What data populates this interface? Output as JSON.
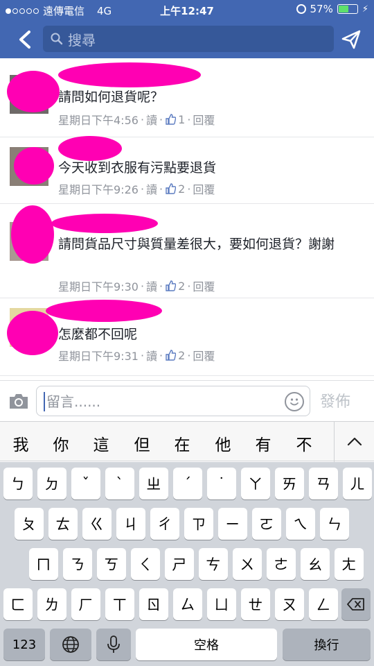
{
  "status_bar": {
    "carrier": "遠傳電信",
    "network": "4G",
    "time": "上午12:47",
    "battery_percent": "57%",
    "battery_level": 0.57
  },
  "nav": {
    "search_placeholder": "搜尋"
  },
  "comments": [
    {
      "text": "請問如何退貨呢？",
      "time": "星期日下午4:56",
      "read": "讀",
      "likes": "1",
      "reply": "回覆"
    },
    {
      "text": "今天收到衣服有污點要退貨",
      "time": "星期日下午9:26",
      "read": "讀",
      "likes": "2",
      "reply": "回覆"
    },
    {
      "text": "請問貨品尺寸與質量差很大，要如何退貨？謝謝",
      "time": "星期日下午9:30",
      "read": "讀",
      "likes": "2",
      "reply": "回覆"
    },
    {
      "text": "怎麼都不回呢",
      "time": "星期日下午9:31",
      "read": "讀",
      "likes": "2",
      "reply": "回覆"
    }
  ],
  "comment_input": {
    "placeholder": "留言......",
    "post_label": "發佈"
  },
  "candidates": [
    "我",
    "你",
    "這",
    "但",
    "在",
    "他",
    "有",
    "不"
  ],
  "keyboard": {
    "row1": [
      "ㄅ",
      "ㄉ",
      "ˇ",
      "ˋ",
      "ㄓ",
      "ˊ",
      "˙",
      "ㄚ",
      "ㄞ",
      "ㄢ",
      "ㄦ"
    ],
    "row2": [
      "ㄆ",
      "ㄊ",
      "ㄍ",
      "ㄐ",
      "ㄔ",
      "ㄗ",
      "ㄧ",
      "ㄛ",
      "ㄟ",
      "ㄣ"
    ],
    "row3": [
      "ㄇ",
      "ㄋ",
      "ㄎ",
      "ㄑ",
      "ㄕ",
      "ㄘ",
      "ㄨ",
      "ㄜ",
      "ㄠ",
      "ㄤ"
    ],
    "row4": [
      "ㄈ",
      "ㄌ",
      "ㄏ",
      "ㄒ",
      "ㄖ",
      "ㄙ",
      "ㄩ",
      "ㄝ",
      "ㄡ",
      "ㄥ"
    ],
    "numbers_label": "123",
    "space_label": "空格",
    "return_label": "換行"
  },
  "colors": {
    "header": "#4267b2",
    "redaction": "#ff00b3"
  }
}
